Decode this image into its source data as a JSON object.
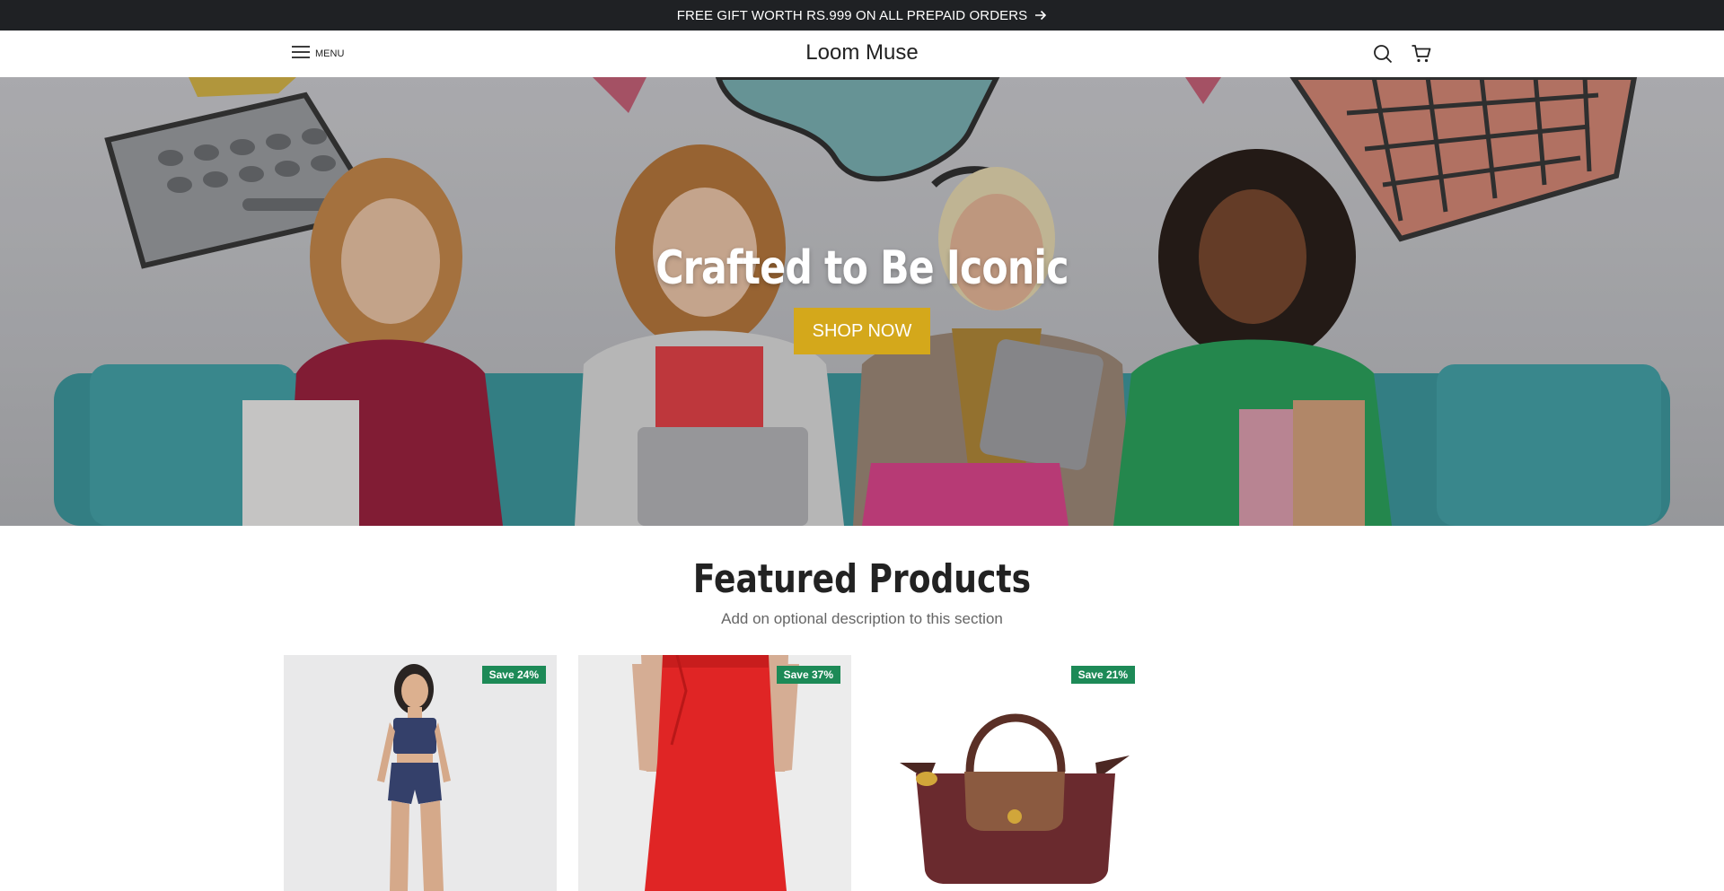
{
  "announcement": {
    "text": "FREE GIFT WORTH RS.999 ON ALL PREPAID ORDERS",
    "icon": "arrow-right-icon"
  },
  "header": {
    "menu_label": "MENU",
    "logo": "Loom Muse",
    "icons": [
      "hamburger-icon",
      "search-icon",
      "cart-icon"
    ]
  },
  "hero": {
    "title": "Crafted to Be Iconic",
    "cta_label": "SHOP NOW",
    "cta_color": "#d4a81b",
    "image": "four women shopping with bags, laptop and tablet on teal sofa"
  },
  "featured": {
    "title": "Featured Products",
    "description": "Add on optional description to this section",
    "products": [
      {
        "badge": "Save 24%",
        "image": "woman in navy tube top and shorts set"
      },
      {
        "badge": "Save 37%",
        "image": "red maxi skirt"
      },
      {
        "badge": "Save 21%",
        "image": "burgundy handbag with brown flap"
      }
    ],
    "badge_color": "#1d8a57"
  }
}
